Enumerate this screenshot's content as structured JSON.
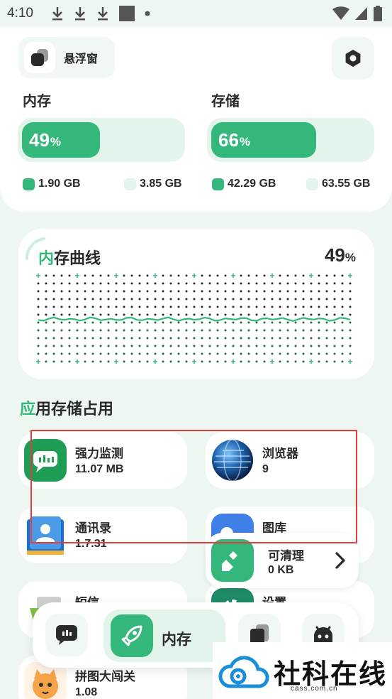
{
  "status_bar": {
    "time": "4:10"
  },
  "header": {
    "float_window_label": "悬浮窗"
  },
  "memory": {
    "title": "内存",
    "percent": "49",
    "percent_sign": "%",
    "fraction": 0.49,
    "used": "1.90 GB",
    "total": "3.85 GB"
  },
  "storage": {
    "title": "存储",
    "percent": "66",
    "percent_sign": "%",
    "fraction": 0.66,
    "used": "42.29 GB",
    "total": "63.55 GB"
  },
  "curve": {
    "title_accent": "内",
    "title_rest": "存曲线",
    "percent": "49",
    "percent_sign": "%"
  },
  "apps_section": {
    "title_accent": "应",
    "title_rest": "用存储占用"
  },
  "apps": [
    {
      "name": "强力监测",
      "size": "11.07 MB"
    },
    {
      "name": "浏览器",
      "size": "9"
    },
    {
      "name": "通讯录",
      "size": "1.7.31"
    },
    {
      "name": "图库",
      "size": ""
    },
    {
      "name": "短信",
      "size": ""
    },
    {
      "name": "设置",
      "size": ""
    },
    {
      "name": "拼图大闯关",
      "size": "1.08"
    }
  ],
  "cleanable": {
    "label": "可清理",
    "size": "0 KB"
  },
  "bottom_nav": {
    "active_label": "内存"
  },
  "watermark": {
    "title": "社科在线",
    "url": "cass.com.cn"
  },
  "colors": {
    "accent": "#34b77a",
    "accent_light": "#e3f4ea",
    "background": "#eef6f2",
    "highlight_box": "#e23c3c"
  }
}
